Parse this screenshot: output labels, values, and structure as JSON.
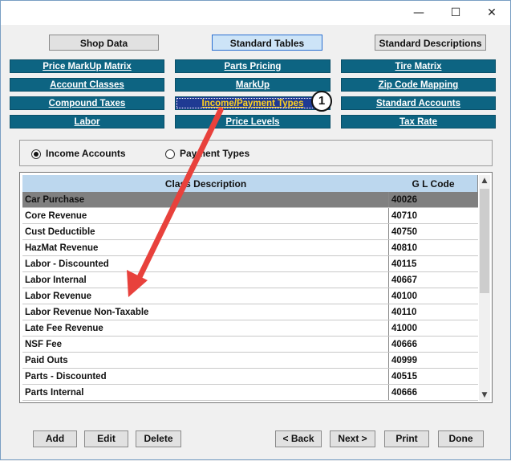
{
  "window": {
    "controls": {
      "minimize": "—",
      "maximize": "☐",
      "close": "✕"
    }
  },
  "top_buttons": [
    "Shop Data",
    "Standard Tables",
    "Standard Descriptions"
  ],
  "table_buttons": {
    "col1": [
      "Price MarkUp Matrix",
      "Account Classes",
      "Compound Taxes",
      "Labor"
    ],
    "col2": [
      "Parts Pricing",
      "MarkUp",
      "Income/Payment Types",
      "Price Levels"
    ],
    "col3": [
      "Tire Matrix",
      "Zip Code Mapping",
      "Standard Accounts",
      "Tax Rate"
    ]
  },
  "callout_number": "1",
  "account_type": {
    "options": [
      "Income Accounts",
      "Payment Types"
    ],
    "selected": "Income Accounts"
  },
  "grid": {
    "columns": [
      "Class Description",
      "G L Code"
    ],
    "rows": [
      {
        "description": "Car Purchase",
        "code": "40026"
      },
      {
        "description": "Core Revenue",
        "code": "40710"
      },
      {
        "description": "Cust Deductible",
        "code": "40750"
      },
      {
        "description": "HazMat Revenue",
        "code": "40810"
      },
      {
        "description": "Labor - Discounted",
        "code": "40115"
      },
      {
        "description": "Labor Internal",
        "code": "40667"
      },
      {
        "description": "Labor Revenue",
        "code": "40100"
      },
      {
        "description": "Labor Revenue Non-Taxable",
        "code": "40110"
      },
      {
        "description": "Late Fee Revenue",
        "code": "41000"
      },
      {
        "description": "NSF Fee",
        "code": "40666"
      },
      {
        "description": "Paid Outs",
        "code": "40999"
      },
      {
        "description": "Parts - Discounted",
        "code": "40515"
      },
      {
        "description": "Parts Internal",
        "code": "40666"
      }
    ],
    "selected_row": "Car Purchase"
  },
  "bottom_buttons": [
    "Add",
    "Edit",
    "Delete",
    "< Back",
    "Next >",
    "Print",
    "Done"
  ],
  "colors": {
    "teal_button": "#0d6482",
    "selected_button": "#1f3a93",
    "arrow": "#e8413c",
    "header": "#bcd7ee"
  }
}
